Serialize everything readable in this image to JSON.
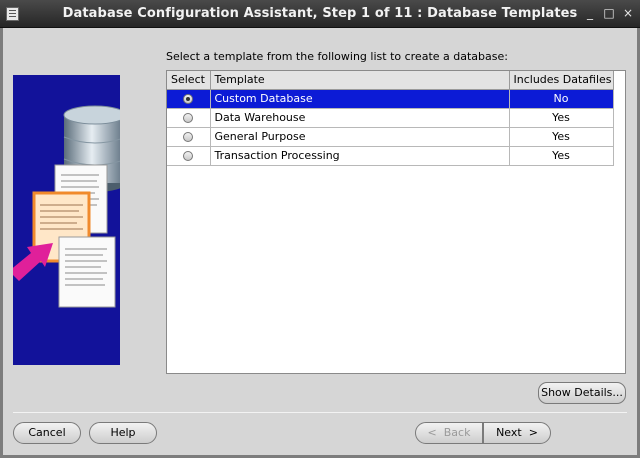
{
  "window": {
    "title": "Database Configuration Assistant, Step 1 of 11 : Database Templates",
    "controls": {
      "minimize": "_",
      "maximize": "□",
      "close": "×"
    }
  },
  "main": {
    "instruction": "Select a template from the following list to create a database:",
    "table": {
      "columns": [
        "Select",
        "Template",
        "Includes Datafiles"
      ],
      "rows": [
        {
          "template": "Custom Database",
          "includes": "No",
          "selected": true
        },
        {
          "template": "Data Warehouse",
          "includes": "Yes",
          "selected": false
        },
        {
          "template": "General Purpose",
          "includes": "Yes",
          "selected": false
        },
        {
          "template": "Transaction Processing",
          "includes": "Yes",
          "selected": false
        }
      ]
    },
    "show_details": "Show Details..."
  },
  "footer": {
    "cancel": "Cancel",
    "help": "Help",
    "back": "Back",
    "next": "Next"
  },
  "colors": {
    "title_bar": "#262626",
    "selection": "#0c1bd6",
    "art_background": "#12129a",
    "arrow": "#e0209a"
  },
  "icons": {
    "art": "database-with-documents-illustration",
    "back": "chevron-left-icon",
    "next": "chevron-right-icon"
  }
}
